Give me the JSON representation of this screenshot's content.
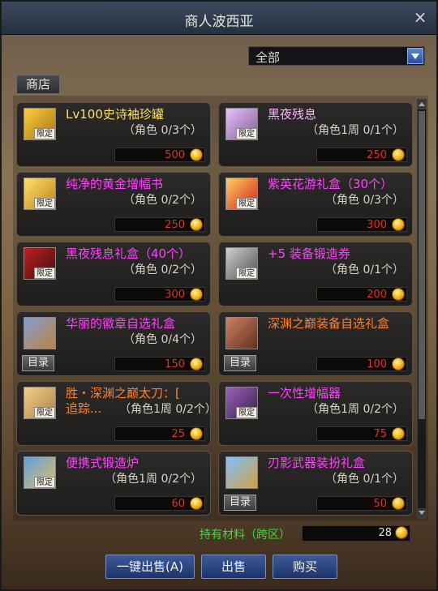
{
  "window": {
    "title": "商人波西亚",
    "close_label": "×"
  },
  "filter": {
    "selected": "全部"
  },
  "tabs": {
    "shop": "商店"
  },
  "items": [
    {
      "name": "Lv100史诗袖珍罐",
      "sub": "（角色 0/3个）",
      "price": "500",
      "badge": "限定",
      "color": "#ffe060",
      "catalog": ""
    },
    {
      "name": "黑夜残息",
      "sub": "（角色1周 0/1个）",
      "price": "250",
      "badge": "限定",
      "color": "#ffb0ff",
      "catalog": ""
    },
    {
      "name": "纯净的黄金增幅书",
      "sub": "（角色 0/2个）",
      "price": "250",
      "badge": "限定",
      "color": "#ff40ff",
      "catalog": ""
    },
    {
      "name": "紫英花游礼盒（30个）",
      "sub": "（角色 0/3个）",
      "price": "300",
      "badge": "限定",
      "color": "#ff40ff",
      "catalog": ""
    },
    {
      "name": "黑夜残息礼盒（40个）",
      "sub": "（角色 0/2个）",
      "price": "300",
      "badge": "限定",
      "color": "#ff40ff",
      "catalog": ""
    },
    {
      "name": "+5 装备锻造券",
      "sub": "（角色 0/1个）",
      "price": "200",
      "badge": "限定",
      "color": "#ff40ff",
      "catalog": ""
    },
    {
      "name": "华丽的徽章自选礼盒",
      "sub": "（角色 0/4个）",
      "price": "150",
      "badge": "",
      "color": "#ff40ff",
      "catalog": "目录"
    },
    {
      "name": "深渊之巅装备自选礼盒",
      "sub": "",
      "price": "100",
      "badge": "",
      "color": "#ff8030",
      "catalog": "目录"
    },
    {
      "name": "胜・深渊之巅太刀：[",
      "name2": "追踪...",
      "sub": "（角色1周 0/2个）",
      "price": "25",
      "badge": "限定",
      "color": "#ff8030",
      "catalog": ""
    },
    {
      "name": "一次性增幅器",
      "sub": "（角色1周 0/2个）",
      "price": "75",
      "badge": "限定",
      "color": "#ff40ff",
      "catalog": ""
    },
    {
      "name": "便携式锻造炉",
      "sub": "（角色1周 0/2个）",
      "price": "60",
      "badge": "限定",
      "color": "#ff40ff",
      "catalog": ""
    },
    {
      "name": "刃影武器装扮礼盒",
      "sub": "（角色 0/1个）",
      "price": "50",
      "badge": "",
      "color": "#ff40ff",
      "catalog": "目录"
    }
  ],
  "material": {
    "label": "持有材料（跨区）",
    "value": "28"
  },
  "buttons": {
    "sell_all": "一键出售(A)",
    "sell": "出售",
    "buy": "购买"
  },
  "colors": {
    "price": "#e03020",
    "material_label": "#2ee62e",
    "button": "#2a4a88"
  }
}
